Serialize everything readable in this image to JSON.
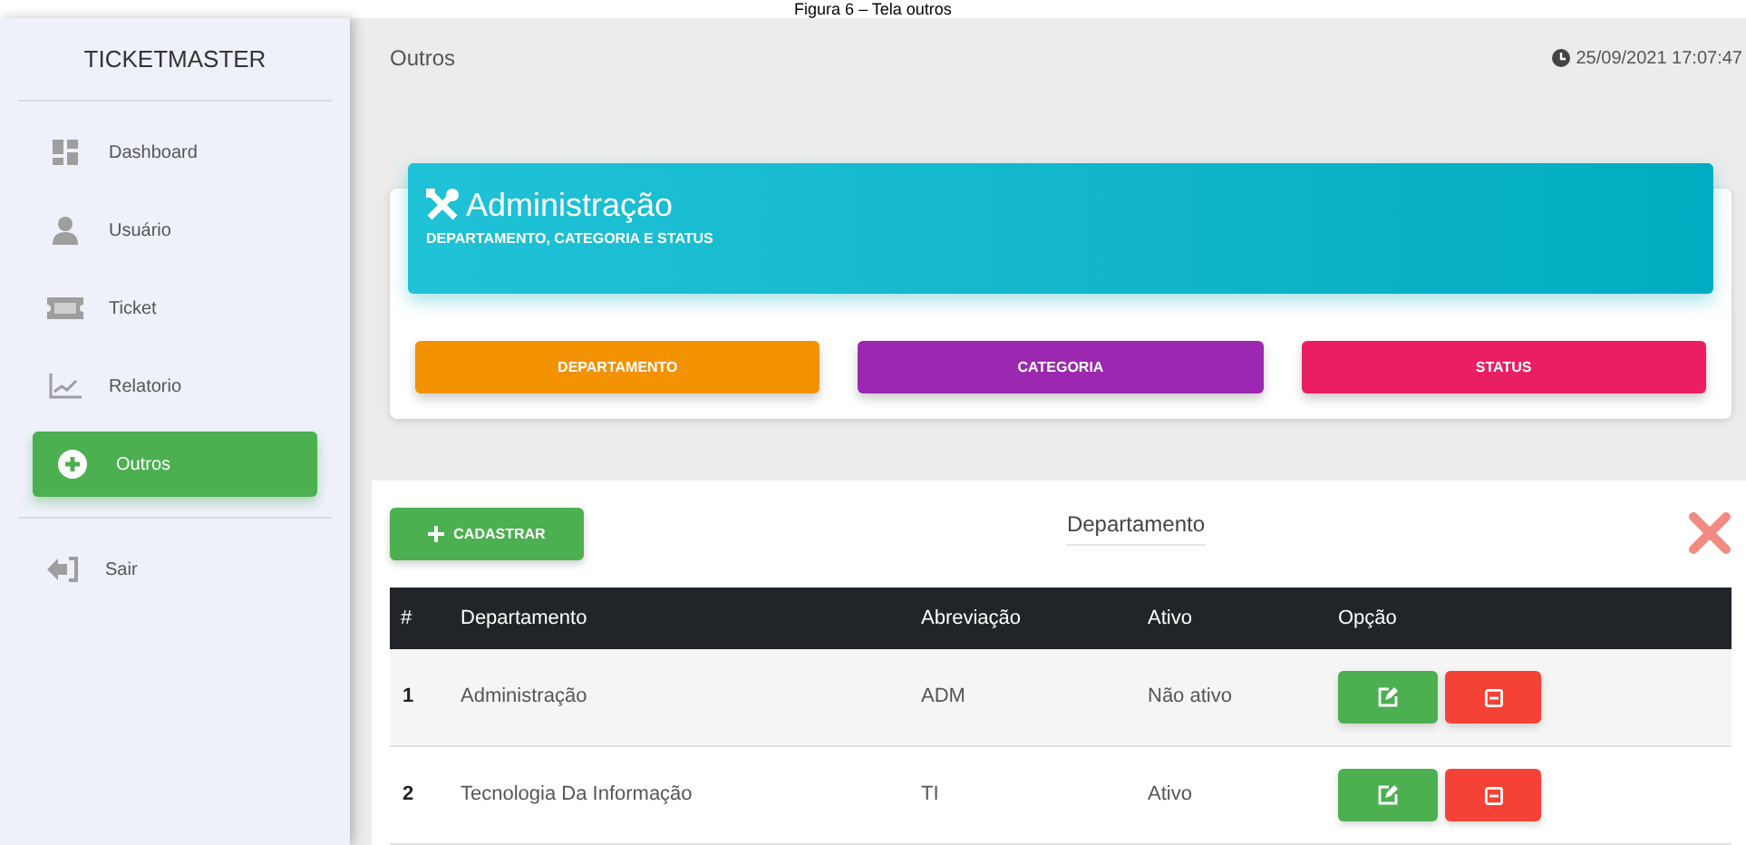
{
  "caption": "Figura 6 – Tela outros",
  "sidebar": {
    "brand": "TICKETMASTER",
    "items": [
      {
        "label": "Dashboard",
        "selected": false
      },
      {
        "label": "Usuário",
        "selected": false
      },
      {
        "label": "Ticket",
        "selected": false
      },
      {
        "label": "Relatorio",
        "selected": false
      },
      {
        "label": "Outros",
        "selected": true
      }
    ],
    "logout": {
      "label": "Sair"
    }
  },
  "header": {
    "title": "Outros",
    "datetime": "25/09/2021 17:07:47"
  },
  "banner": {
    "title": "Administração",
    "subtitle": "DEPARTAMENTO, CATEGORIA E STATUS"
  },
  "sections": [
    {
      "label": "DEPARTAMENTO",
      "color": "#f39200"
    },
    {
      "label": "CATEGORIA",
      "color": "#9c27b0"
    },
    {
      "label": "STATUS",
      "color": "#e91e63"
    }
  ],
  "panel": {
    "add_button": "CADASTRAR",
    "title": "Departamento",
    "table": {
      "columns": [
        "#",
        "Departamento",
        "Abreviação",
        "Ativo",
        "Opção"
      ],
      "rows": [
        {
          "index": "1",
          "name": "Administração",
          "abbr": "ADM",
          "active": "Não ativo"
        },
        {
          "index": "2",
          "name": "Tecnologia Da Informação",
          "abbr": "TI",
          "active": "Ativo"
        }
      ]
    }
  }
}
